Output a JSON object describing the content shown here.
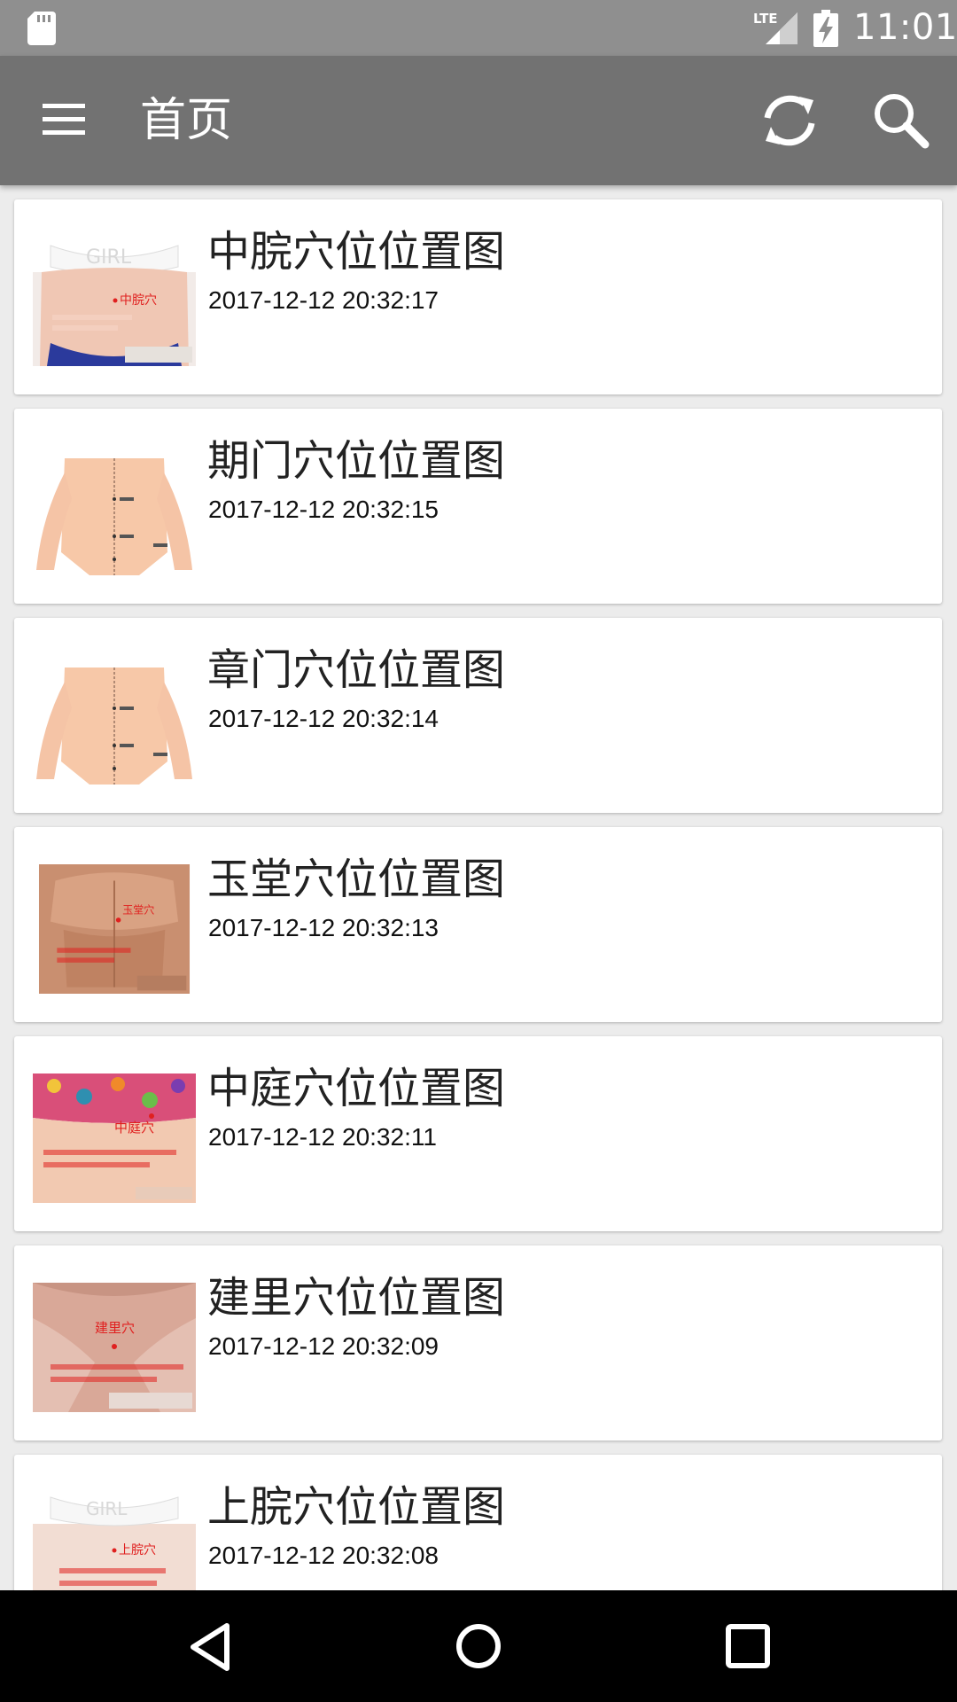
{
  "status_bar": {
    "time": "11:01",
    "network_label": "LTE",
    "icons": [
      "sd-card-icon",
      "lte-signal-icon",
      "battery-charging-icon"
    ]
  },
  "app_bar": {
    "title": "首页",
    "icons": [
      "menu-icon",
      "refresh-icon",
      "search-icon"
    ]
  },
  "items": [
    {
      "title": "中脘穴位位置图",
      "date": "2017-12-12 20:32:17",
      "thumb_label": "中脘穴",
      "thumb_caption": "中脘穴位于上腹部，胸骨下端和肚脐连线中点",
      "thumb_top_text": "GIRL"
    },
    {
      "title": "期门穴位位置图",
      "date": "2017-12-12 20:32:15"
    },
    {
      "title": "章门穴位位置图",
      "date": "2017-12-12 20:32:14"
    },
    {
      "title": "玉堂穴位位置图",
      "date": "2017-12-12 20:32:13",
      "thumb_label": "玉堂穴",
      "thumb_caption": "玉堂穴位于人体的胸部，当前正中线上，平第3肋间"
    },
    {
      "title": "中庭穴位位置图",
      "date": "2017-12-12 20:32:11",
      "thumb_label": "中庭穴",
      "thumb_caption": "中庭穴位于胸部，当前正中线上，平第5肋间，即胸剑结合部"
    },
    {
      "title": "建里穴位位置图",
      "date": "2017-12-12 20:32:09",
      "thumb_label": "建里穴",
      "thumb_caption": "建里穴位于人体的上腹部，前正中线上，当脐中上3寸"
    },
    {
      "title": "上脘穴位位置图",
      "date": "2017-12-12 20:32:08",
      "thumb_label": "上脘穴",
      "thumb_caption": "上脘穴位于人体的上腹部，前正中线上，当脐中上5寸"
    }
  ],
  "nav_bar": {
    "buttons": [
      "back-button",
      "home-button",
      "recents-button"
    ]
  },
  "colors": {
    "status_bar": "#8f8f8f",
    "app_bar": "#727272",
    "background": "#ececec",
    "card": "#ffffff",
    "accent_red": "#e0201f",
    "nav_bar": "#000000"
  }
}
